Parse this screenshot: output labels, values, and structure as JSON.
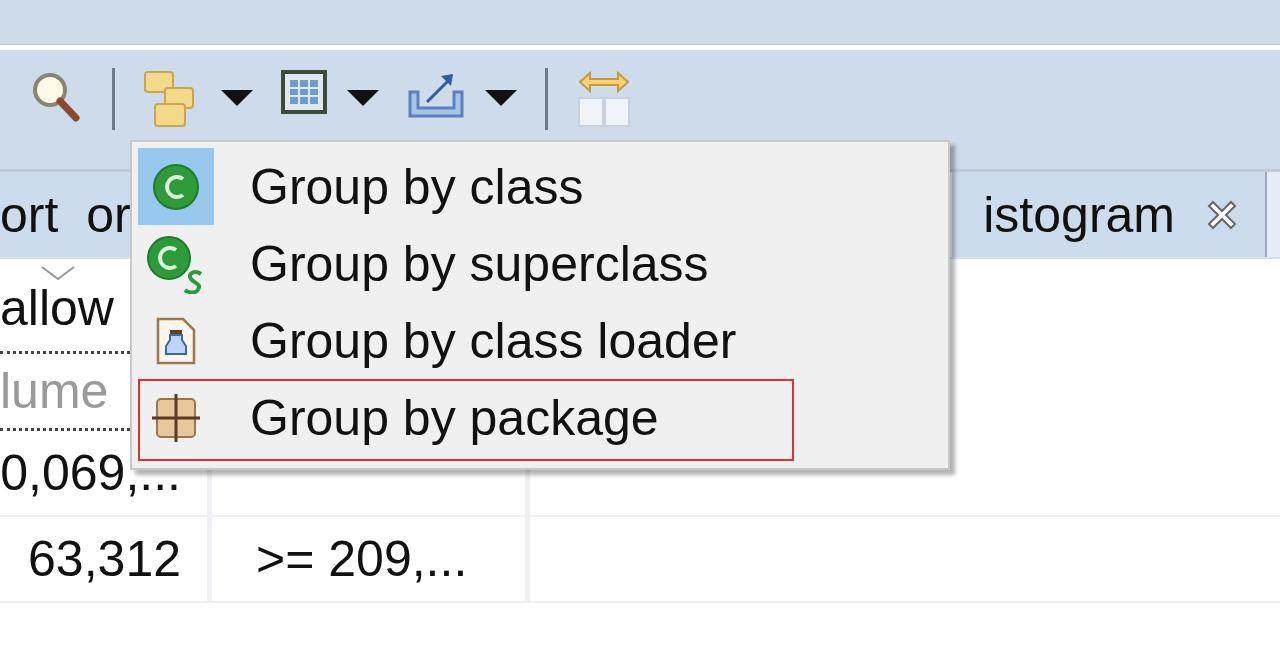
{
  "tabs": [
    {
      "label": "ort  or"
    },
    {
      "label": "istogram",
      "closable": true
    }
  ],
  "table": {
    "columns": [
      {
        "label": "allow",
        "sorted": true
      }
    ],
    "filter_row": [
      "lume"
    ],
    "rows": [
      [
        "0,069,..."
      ],
      [
        "63,312",
        ">= 209,..."
      ]
    ]
  },
  "menu": {
    "items": [
      {
        "label": "Group by class",
        "kind": "class",
        "selected": true,
        "outlined": false
      },
      {
        "label": "Group by superclass",
        "kind": "superclass",
        "selected": false,
        "outlined": false
      },
      {
        "label": "Group by class loader",
        "kind": "loader",
        "selected": false,
        "outlined": false
      },
      {
        "label": "Group by package",
        "kind": "package",
        "selected": false,
        "outlined": true
      }
    ]
  }
}
